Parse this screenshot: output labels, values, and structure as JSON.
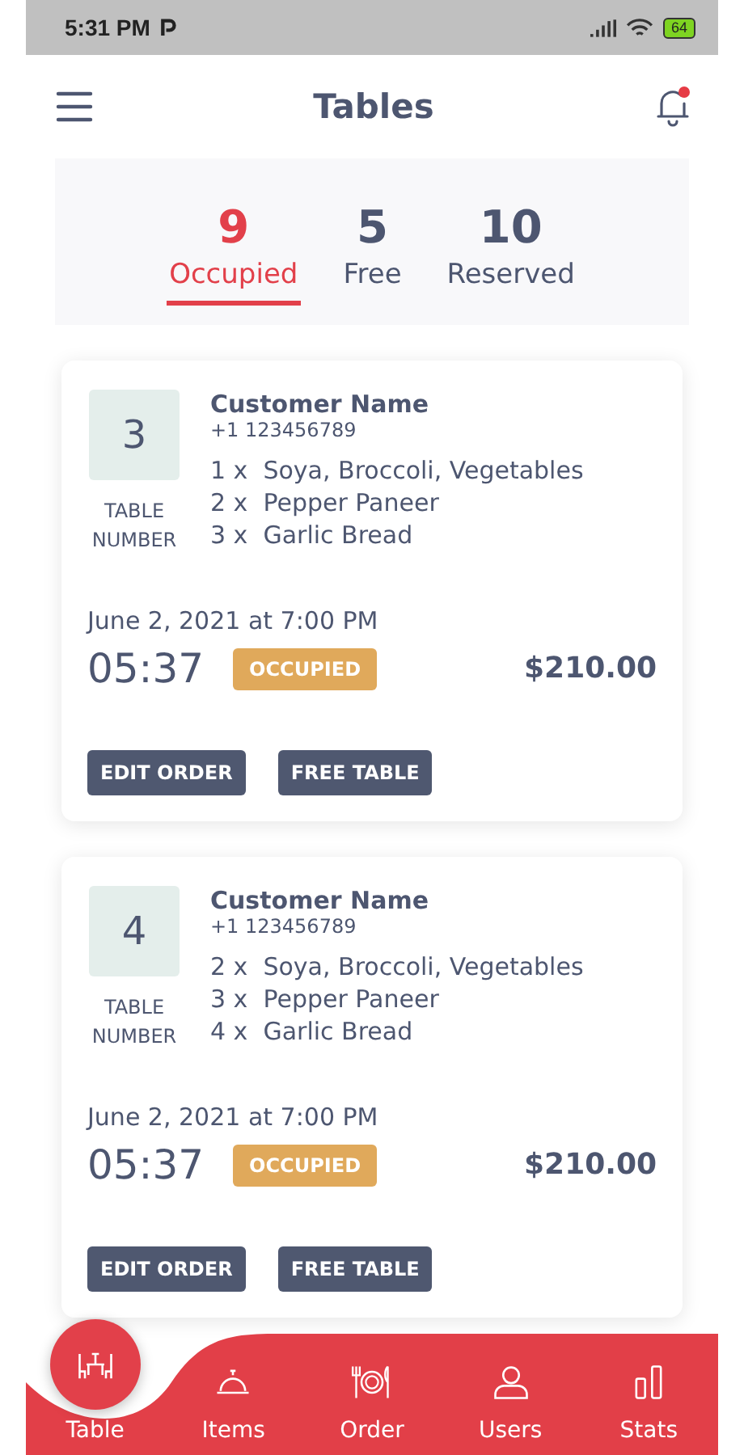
{
  "status_bar": {
    "time": "5:31 PM",
    "battery": "64"
  },
  "header": {
    "title": "Tables",
    "has_notification": true
  },
  "tabs": [
    {
      "count": "9",
      "label": "Occupied",
      "selected": true
    },
    {
      "count": "5",
      "label": "Free",
      "selected": false
    },
    {
      "count": "10",
      "label": "Reserved",
      "selected": false
    }
  ],
  "cards": [
    {
      "table_number": "3",
      "table_label": "TABLE NUMBER",
      "customer": "Customer Name",
      "phone": "+1 123456789",
      "items": [
        {
          "qty": "1 x",
          "name": "Soya, Broccoli, Vegetables"
        },
        {
          "qty": "2 x",
          "name": "Pepper Paneer"
        },
        {
          "qty": "3 x",
          "name": "Garlic Bread"
        }
      ],
      "date": "June 2, 2021 at 7:00 PM",
      "timer": "05:37",
      "status": "OCCUPIED",
      "total": "$210.00",
      "buttons": [
        "EDIT ORDER",
        "FREE TABLE"
      ]
    },
    {
      "table_number": "4",
      "table_label": "TABLE NUMBER",
      "customer": "Customer Name",
      "phone": "+1 123456789",
      "items": [
        {
          "qty": "2 x",
          "name": "Soya, Broccoli, Vegetables"
        },
        {
          "qty": "3 x",
          "name": "Pepper Paneer"
        },
        {
          "qty": "4 x",
          "name": "Garlic Bread"
        }
      ],
      "date": "June 2, 2021 at 7:00 PM",
      "timer": "05:37",
      "status": "OCCUPIED",
      "total": "$210.00",
      "buttons": [
        "EDIT ORDER",
        "FREE TABLE"
      ]
    }
  ],
  "nav": [
    {
      "label": "Table",
      "kind": "table",
      "selected": true
    },
    {
      "label": "Items",
      "kind": "items",
      "selected": false
    },
    {
      "label": "Order",
      "kind": "order",
      "selected": false
    },
    {
      "label": "Users",
      "kind": "users",
      "selected": false
    },
    {
      "label": "Stats",
      "kind": "stats",
      "selected": false
    }
  ]
}
